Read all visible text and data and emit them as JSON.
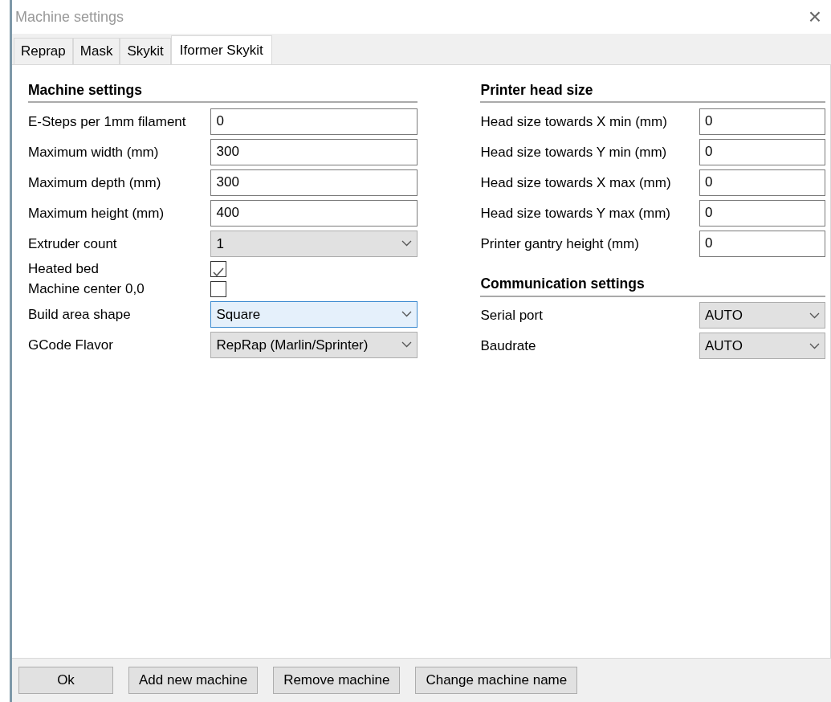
{
  "window": {
    "title": "Machine settings",
    "close": "×"
  },
  "tabs": [
    {
      "label": "Reprap",
      "selected": false
    },
    {
      "label": "Mask",
      "selected": false
    },
    {
      "label": "Skykit",
      "selected": false
    },
    {
      "label": "Iformer Skykit",
      "selected": true
    }
  ],
  "columns": [
    {
      "sections": [
        {
          "title": "Machine settings",
          "fields": [
            {
              "kind": "text",
              "label": "E-Steps per 1mm filament",
              "value": "0"
            },
            {
              "kind": "text",
              "label": "Maximum width (mm)",
              "value": "300"
            },
            {
              "kind": "text",
              "label": "Maximum depth (mm)",
              "value": "300"
            },
            {
              "kind": "text",
              "label": "Maximum height (mm)",
              "value": "400"
            },
            {
              "kind": "select",
              "label": "Extruder count",
              "value": "1",
              "focused": false
            },
            {
              "kind": "checkbox",
              "label": "Heated bed",
              "checked": true
            },
            {
              "kind": "checkbox",
              "label": "Machine center 0,0",
              "checked": false
            },
            {
              "kind": "select",
              "label": "Build area shape",
              "value": "Square",
              "focused": true
            },
            {
              "kind": "select",
              "label": "GCode Flavor",
              "value": "RepRap (Marlin/Sprinter)",
              "focused": false
            }
          ]
        }
      ]
    },
    {
      "sections": [
        {
          "title": "Printer head size",
          "fields": [
            {
              "kind": "text",
              "label": "Head size towards X min (mm)",
              "value": "0"
            },
            {
              "kind": "text",
              "label": "Head size towards Y min (mm)",
              "value": "0"
            },
            {
              "kind": "text",
              "label": "Head size towards X max (mm)",
              "value": "0"
            },
            {
              "kind": "text",
              "label": "Head size towards Y max (mm)",
              "value": "0"
            },
            {
              "kind": "text",
              "label": "Printer gantry height (mm)",
              "value": "0"
            }
          ]
        },
        {
          "title": "Communication settings",
          "fields": [
            {
              "kind": "select",
              "label": "Serial port",
              "value": "AUTO",
              "focused": false
            },
            {
              "kind": "select",
              "label": "Baudrate",
              "value": "AUTO",
              "focused": false
            }
          ]
        }
      ]
    }
  ],
  "buttons": [
    "Ok",
    "Add new machine",
    "Remove machine",
    "Change machine name"
  ]
}
